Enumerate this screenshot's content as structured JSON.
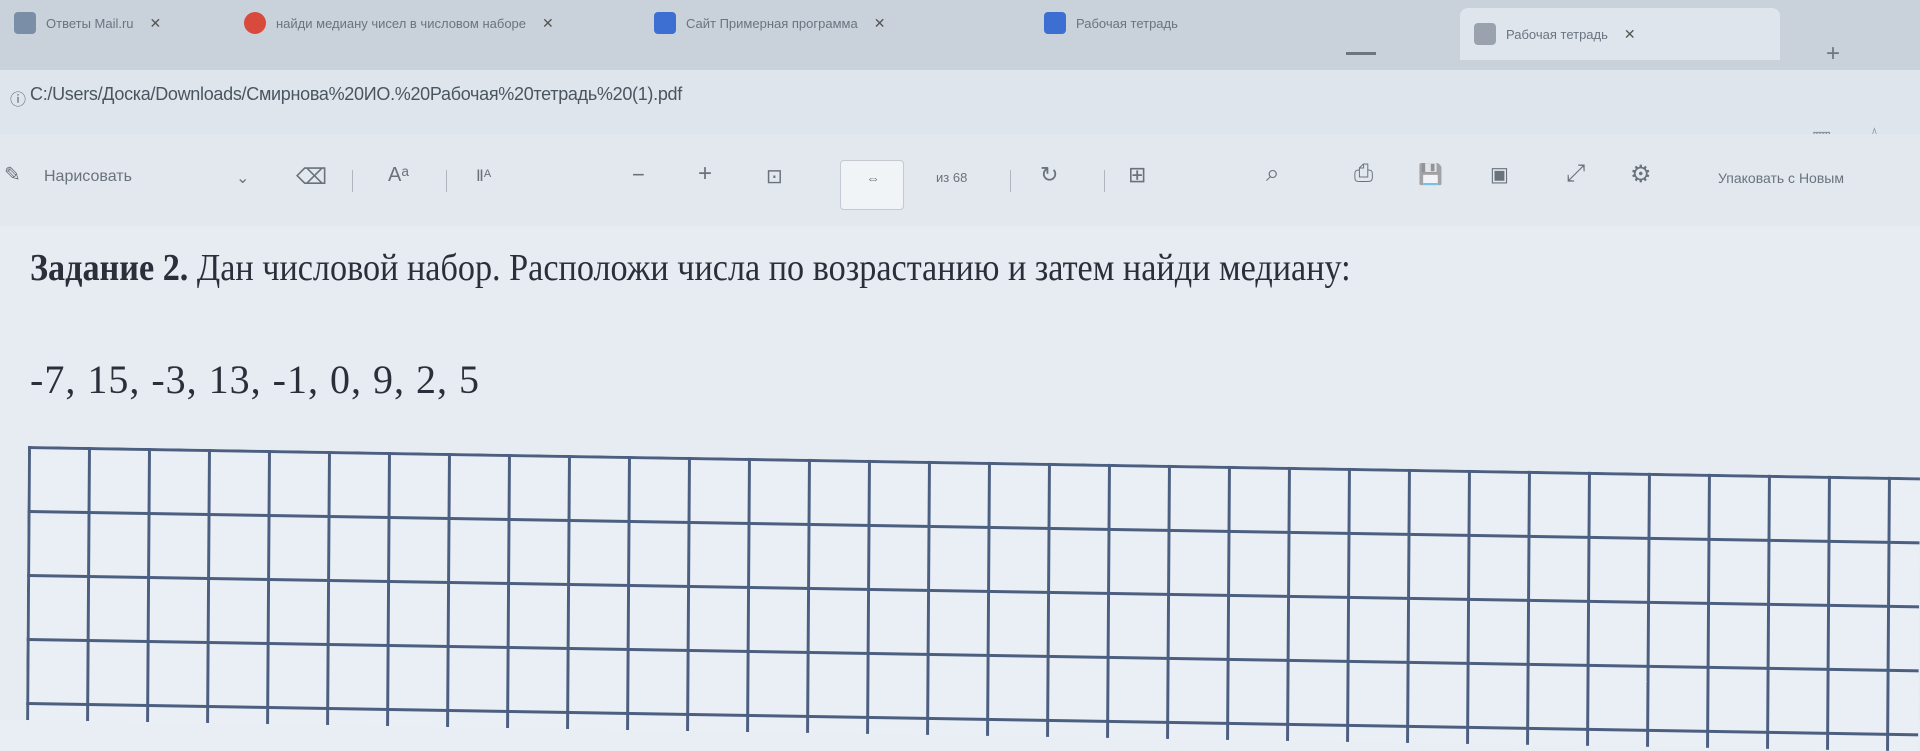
{
  "tabs": [
    {
      "label": "Ответы Mail.ru",
      "favicon_color": "#7a8ea8"
    },
    {
      "label": "найди медиану чисел в числовом наборе",
      "favicon_color": "#d74a3c"
    },
    {
      "label": "Сайт Примерная программа",
      "favicon_color": "#3c6fd1"
    },
    {
      "label": "Рабочая тетрадь",
      "favicon_color": "#3c6fd1"
    },
    {
      "label": "Рабочая тетрадь",
      "favicon_color": "#9aa3ad"
    }
  ],
  "tab_close_glyph": "✕",
  "newtab_glyph": "+",
  "address": {
    "info_glyph": "ⓘ",
    "url": "C:/Users/Доска/Downloads/Смирнова%20ИО.%20Рабочая%20тетрадь%20(1).pdf"
  },
  "toolbar": {
    "draw_label": "Нарисовать",
    "erase_icon": "eraser-icon",
    "text_size_label": "Aᵃ",
    "read_aloud_label": "Ⅱᴬ",
    "zoom_out": "−",
    "zoom_in": "+",
    "fit_label": "⊡",
    "page_label": "⇔",
    "pages_label": "из 68",
    "rotate_label": "↻",
    "two_page_label": "⊞",
    "search_glyph": "⌕",
    "print_glyph": "⎙",
    "save_glyph": "💾",
    "fullscreen_glyph": "⤢",
    "settings_glyph": "⚙",
    "fit_width_label": "Упаковать с Новым"
  },
  "document": {
    "task_number": "Задание 2.",
    "task_text": " Дан числовой набор. Расположи числа по возрастанию и затем найди медиану:",
    "numbers": "-7,  15, -3, 13, -1, 0, 9, 2, 5"
  }
}
